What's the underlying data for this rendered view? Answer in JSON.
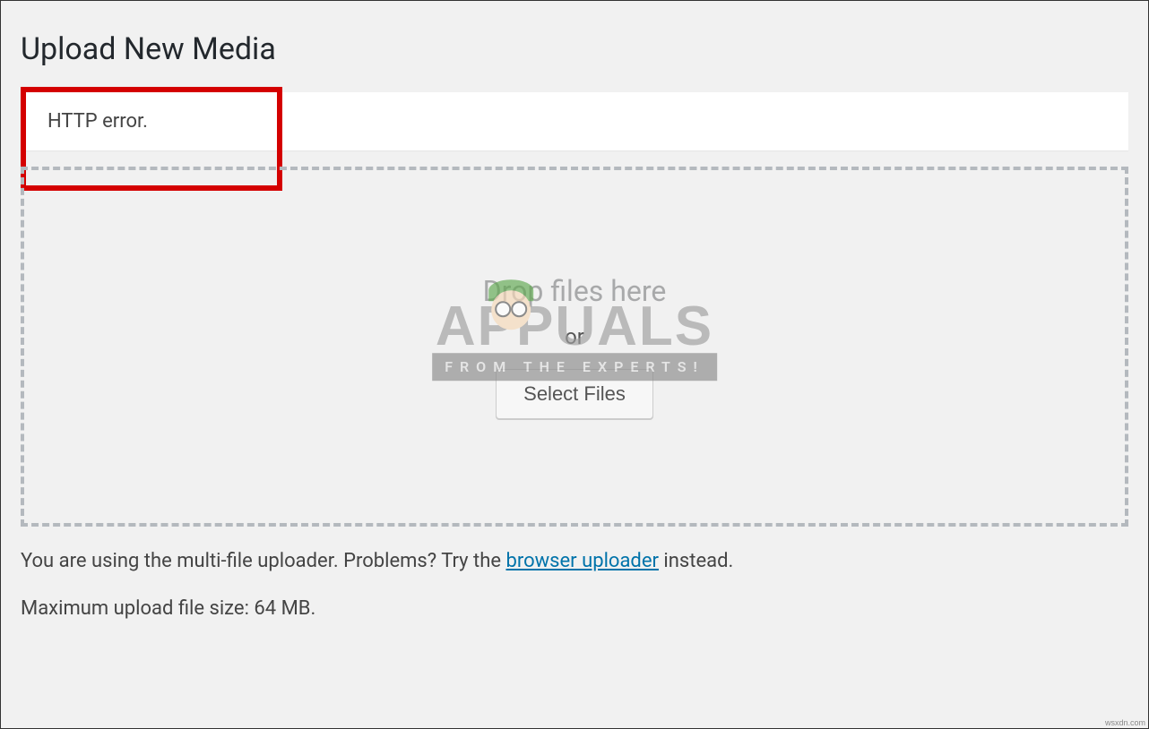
{
  "page": {
    "title": "Upload New Media"
  },
  "error": {
    "message": "HTTP error."
  },
  "dropzone": {
    "drop_text": "Drop files here",
    "or_text": "or",
    "select_button": "Select Files"
  },
  "info": {
    "uploader_text_prefix": "You are using the multi-file uploader. Problems? Try the ",
    "uploader_link": "browser uploader",
    "uploader_text_suffix": " instead.",
    "max_size_text": "Maximum upload file size: 64 MB."
  },
  "watermark": {
    "brand": "APPUALS",
    "tagline": "FROM   THE   EXPERTS!"
  },
  "footer": {
    "mark": "wsxdn.com"
  }
}
